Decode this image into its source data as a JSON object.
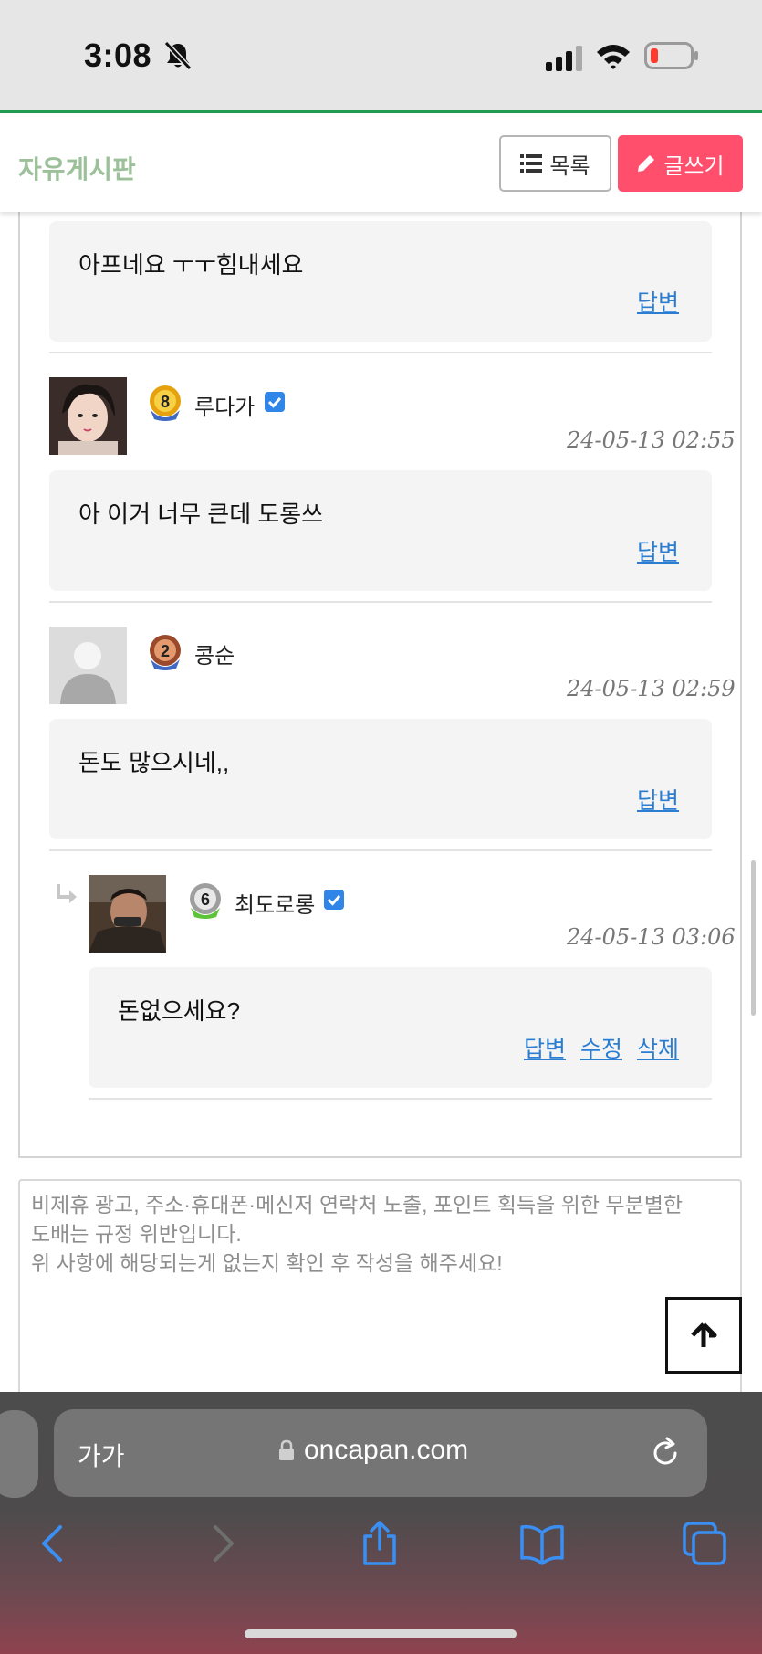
{
  "status_bar": {
    "time": "3:08"
  },
  "header": {
    "board_title": "자유게시판",
    "list_button": "목록",
    "write_button": "글쓰기"
  },
  "comments": [
    {
      "text": "아프네요 ㅜㅜ힘내세요",
      "links": [
        "답변"
      ]
    },
    {
      "nickname": "루다가",
      "level": "8",
      "verified": true,
      "date": "24-05-13 02:55",
      "text": "아 이거 너무 큰데 도롱쓰",
      "links": [
        "답변"
      ]
    },
    {
      "nickname": "콩순",
      "level": "2",
      "verified": false,
      "date": "24-05-13 02:59",
      "text": "돈도 많으시네,,",
      "links": [
        "답변"
      ]
    },
    {
      "nickname": "최도로롱",
      "level": "6",
      "verified": true,
      "date": "24-05-13 03:06",
      "text": "돈없으세요?",
      "links": [
        "답변",
        "수정",
        "삭제"
      ],
      "is_reply": true
    }
  ],
  "comment_form": {
    "placeholder_lines": [
      "비제휴 광고, 주소·휴대폰·메신저 연락처 노출, 포인트 획득을 위한 무분별한",
      "도배는 규정 위반입니다.",
      "위 사항에 해당되는게 없는지 확인 후 작성을 해주세요!"
    ]
  },
  "browser": {
    "text_size_button": "가가",
    "url": "oncapan.com"
  },
  "colors": {
    "accent_green": "#1e9b4f",
    "title_green": "#9cc19a",
    "write_button": "#ff4f6d",
    "link_blue": "#2a7dd1"
  }
}
